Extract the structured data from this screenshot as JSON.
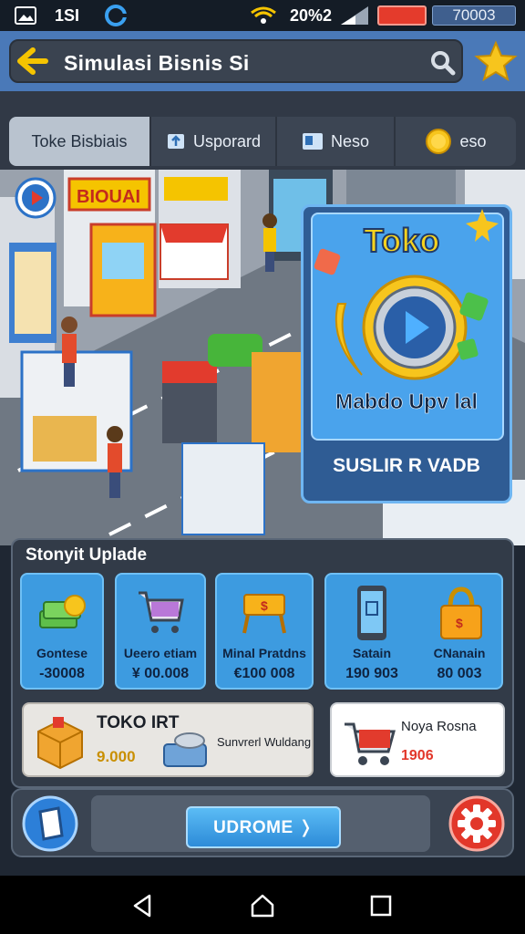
{
  "status_bar": {
    "time": "1SI",
    "battery_pct": "20%2",
    "counter": "70003"
  },
  "header": {
    "title": "Simulasi Bisnis Si"
  },
  "tabs": [
    {
      "label": "Toke Bisbiais",
      "icon": "store-icon",
      "active": true
    },
    {
      "label": "Usporard",
      "icon": "upgrade-icon",
      "active": false
    },
    {
      "label": "Neso",
      "icon": "news-icon",
      "active": false
    },
    {
      "label": "eso",
      "icon": "coin-icon",
      "active": false
    }
  ],
  "promo": {
    "title": "Toko",
    "subtitle": "Mabdo Upv lal",
    "footer": "SUSLIR R VADB"
  },
  "upgrades": {
    "title": "Stonyit Uplade",
    "cards": [
      {
        "label": "Gontese",
        "value": "-30008",
        "icon": "cash-icon"
      },
      {
        "label": "Ueero etiam",
        "value": "¥ 00.008",
        "icon": "cart-icon"
      },
      {
        "label": "Minal Pratdns",
        "value": "€100 008",
        "icon": "stall-icon"
      },
      {
        "label": "Satain",
        "value": "190 903",
        "icon": "phone-icon"
      },
      {
        "label": "CNanain",
        "value": "80 003",
        "icon": "lock-bag-icon"
      }
    ],
    "wide_left": {
      "title": "TOKO IRT",
      "value": "9.000",
      "caption": "Sunvrerl Wuldang"
    },
    "wide_right": {
      "title": "Noya Rosna",
      "value": "1906"
    }
  },
  "bottom": {
    "upgrade_label": "UDROME ❭"
  },
  "colors": {
    "header": "#4a79b8",
    "card": "#3d9be0",
    "accent": "#f5c400",
    "danger": "#e2372a"
  }
}
